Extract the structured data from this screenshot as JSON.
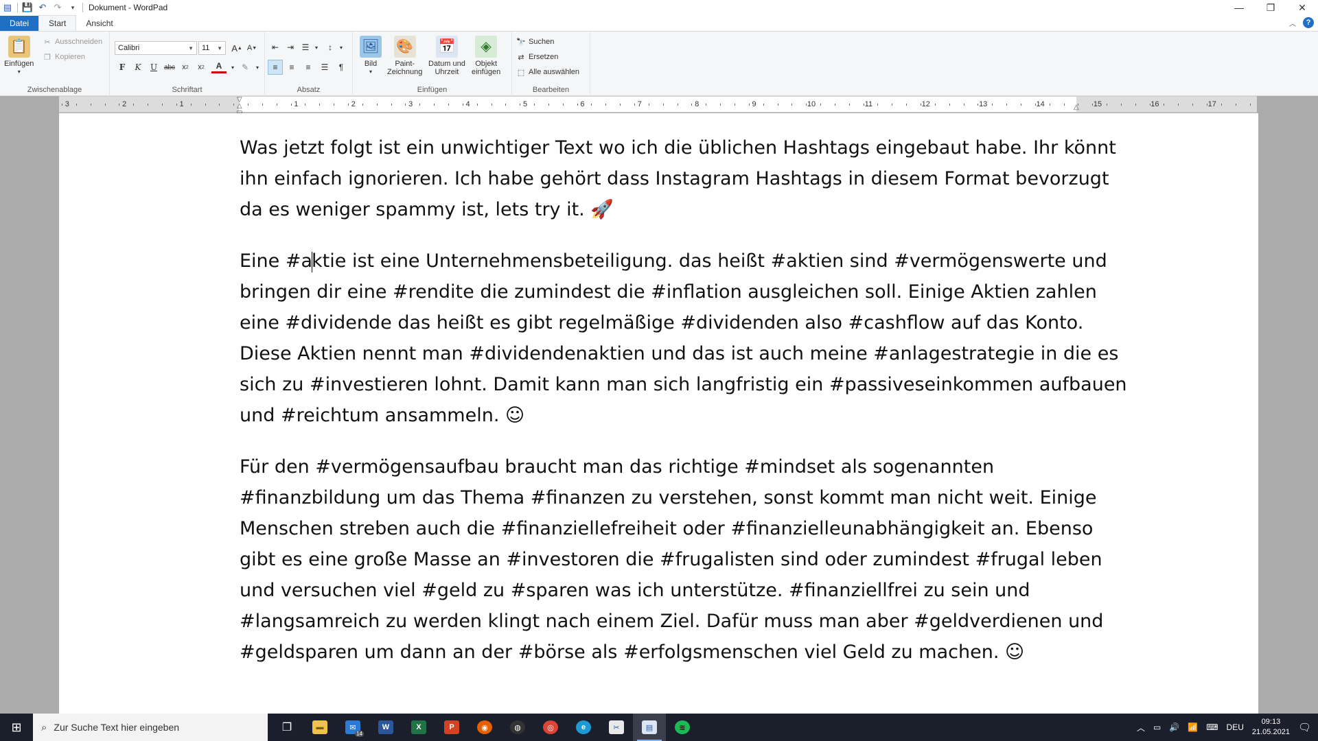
{
  "window": {
    "title": "Dokument - WordPad"
  },
  "tabs": [
    {
      "label": "Datei"
    },
    {
      "label": "Start"
    },
    {
      "label": "Ansicht"
    }
  ],
  "ribbon": {
    "clipboard": {
      "label": "Zwischenablage",
      "paste": "Einfügen",
      "cut": "Ausschneiden",
      "copy": "Kopieren"
    },
    "font": {
      "label": "Schriftart",
      "family": "Calibri",
      "size": "11"
    },
    "paragraph": {
      "label": "Absatz"
    },
    "insert": {
      "label": "Einfügen",
      "picture": "Bild",
      "paint_1": "Paint-",
      "paint_2": "Zeichnung",
      "datetime_1": "Datum und",
      "datetime_2": "Uhrzeit",
      "object_1": "Objekt",
      "object_2": "einfügen"
    },
    "edit": {
      "label": "Bearbeiten",
      "find": "Suchen",
      "replace": "Ersetzen",
      "select_all": "Alle auswählen"
    }
  },
  "ruler": {
    "numbers": [
      "3",
      "2",
      "1",
      "1",
      "2",
      "3",
      "4",
      "5",
      "6",
      "7",
      "8",
      "9",
      "10",
      "11",
      "12",
      "13",
      "14",
      "15",
      "16",
      "17"
    ]
  },
  "document": {
    "p1": "Was jetzt folgt ist ein unwichtiger Text wo ich die üblichen Hashtags eingebaut habe. Ihr könnt ihn einfach ignorieren. Ich habe gehört dass Instagram Hashtags in diesem Format bevorzugt da es weniger spammy ist, lets try it. 🚀",
    "p2_before_caret": "Eine #a",
    "p2_after_caret": "ktie ist eine Unternehmensbeteiligung. das heißt #aktien sind #vermögenswerte und bringen dir eine #rendite die zumindest die #inflation ausgleichen soll. Einige Aktien zahlen eine #dividende das heißt es gibt regelmäßige #dividenden also #cashflow auf das Konto. Diese Aktien nennt man #dividendenaktien und das ist auch meine #anlagestrategie in die es sich zu #investieren lohnt. Damit kann man sich langfristig ein #passiveseinkommen aufbauen und #reichtum ansammeln. ☺",
    "p3": "Für den #vermögensaufbau braucht man das richtige #mindset als sogenannten #finanzbildung um das Thema #finanzen zu verstehen, sonst kommt man nicht weit. Einige Menschen streben auch die #finanziellefreiheit oder #finanzielleunabhängigkeit an. Ebenso gibt es eine große Masse an #investoren die #frugalisten sind oder zumindest #frugal leben und versuchen viel #geld zu #sparen was ich unterstütze. #finanziellfrei zu sein und #langsamreich zu werden klingt nach einem Ziel. Dafür muss man aber #geldverdienen und #geldsparen um dann an der #börse als #erfolgsmenschen viel Geld zu machen. ☺"
  },
  "taskbar": {
    "search_placeholder": "Zur Suche Text hier eingeben",
    "mail_badge": "14",
    "language": "DEU",
    "time": "09:13",
    "date": "21.05.2021"
  }
}
